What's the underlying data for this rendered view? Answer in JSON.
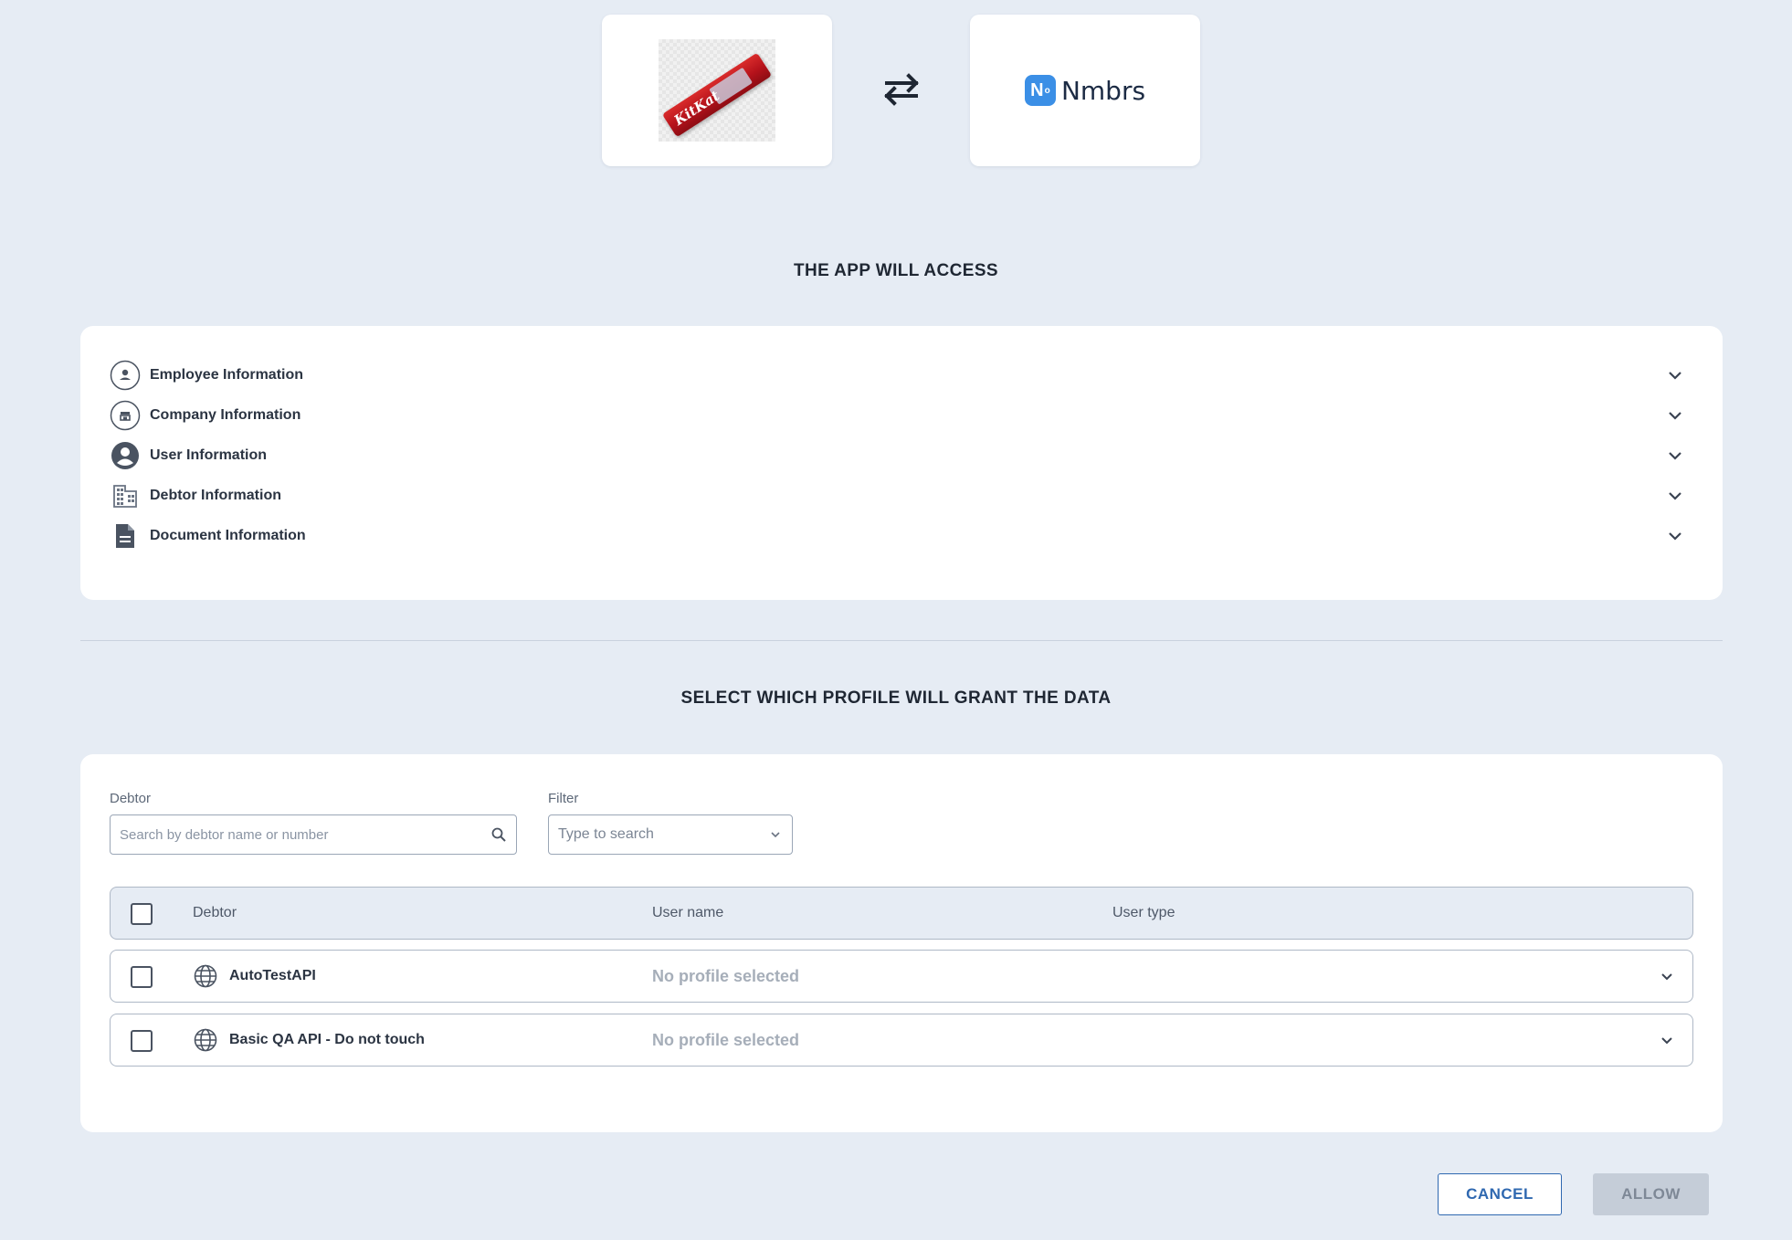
{
  "header": {
    "app_logo": {
      "icon": "kitkat-product-image",
      "label": "KitKat"
    },
    "swap_icon": "swap-arrows-icon",
    "partner_logo": {
      "mark": "N",
      "mark_sup": "o",
      "name": "Nmbrs",
      "color": "#3b8fe6"
    }
  },
  "access": {
    "title": "THE APP WILL ACCESS",
    "items": [
      {
        "label": "Employee Information",
        "icon": "person-circle-icon"
      },
      {
        "label": "Company Information",
        "icon": "company-circle-icon"
      },
      {
        "label": "User Information",
        "icon": "account-circle-icon"
      },
      {
        "label": "Debtor Information",
        "icon": "building-icon"
      },
      {
        "label": "Document Information",
        "icon": "document-icon"
      }
    ]
  },
  "profile": {
    "title": "SELECT WHICH PROFILE WILL GRANT THE DATA",
    "debtor_field": {
      "label": "Debtor",
      "placeholder": "Search by debtor name or number"
    },
    "filter_field": {
      "label": "Filter",
      "placeholder": "Type to search"
    },
    "table": {
      "headers": {
        "debtor": "Debtor",
        "user_name": "User name",
        "user_type": "User type"
      },
      "rows": [
        {
          "debtor": "AutoTestAPI",
          "profile": "No profile selected",
          "checked": false
        },
        {
          "debtor": "Basic QA API - Do not touch",
          "profile": "No profile selected",
          "checked": false
        }
      ]
    }
  },
  "actions": {
    "cancel": "CANCEL",
    "allow": "ALLOW"
  },
  "colors": {
    "background": "#e6ecf4",
    "primary": "#2f68b0",
    "disabled": "#c5cdd8"
  }
}
